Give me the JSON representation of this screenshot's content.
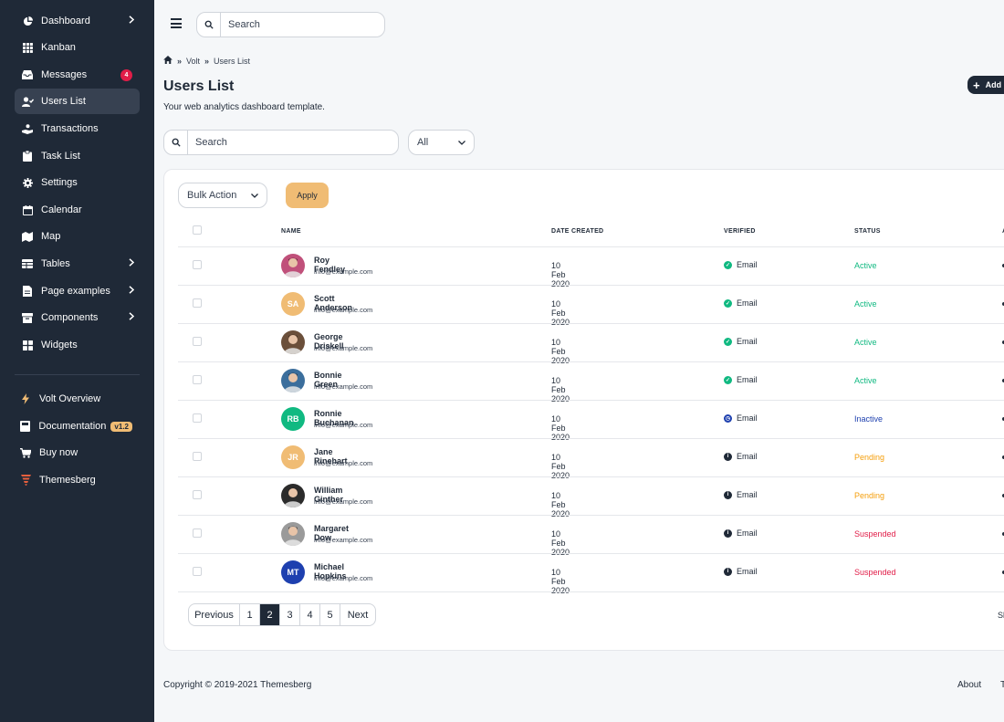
{
  "sidebar": {
    "items": [
      {
        "label": "Dashboard",
        "icon": "pie-chart-icon",
        "chevron": true
      },
      {
        "label": "Kanban",
        "icon": "grid-icon"
      },
      {
        "label": "Messages",
        "icon": "inbox-icon",
        "badge": "4"
      },
      {
        "label": "Users List",
        "icon": "user-check-icon",
        "active": true
      },
      {
        "label": "Transactions",
        "icon": "hand-coin-icon"
      },
      {
        "label": "Task List",
        "icon": "clipboard-icon"
      },
      {
        "label": "Settings",
        "icon": "gear-icon"
      },
      {
        "label": "Calendar",
        "icon": "calendar-icon"
      },
      {
        "label": "Map",
        "icon": "map-icon"
      },
      {
        "label": "Tables",
        "icon": "table-icon",
        "chevron": true
      },
      {
        "label": "Page examples",
        "icon": "document-icon",
        "chevron": true
      },
      {
        "label": "Components",
        "icon": "box-icon",
        "chevron": true
      },
      {
        "label": "Widgets",
        "icon": "widgets-icon"
      }
    ],
    "bottom_items": [
      {
        "label": "Volt Overview",
        "icon": "bolt-icon"
      },
      {
        "label": "Documentation",
        "icon": "book-icon",
        "badge": "v1.2"
      },
      {
        "label": "Buy now",
        "icon": "cart-icon"
      },
      {
        "label": "Themesberg",
        "icon": "themesberg-logo-icon"
      }
    ]
  },
  "topbar": {
    "search_placeholder": "Search"
  },
  "breadcrumb": {
    "items": [
      "Volt",
      "Users List"
    ]
  },
  "page": {
    "title": "Users List",
    "subtitle": "Your web analytics dashboard template.",
    "add_label": "Add"
  },
  "filters": {
    "search_placeholder": "Search",
    "select_value": "All"
  },
  "table": {
    "bulk_action": "Bulk Action",
    "apply": "Apply",
    "columns": [
      "NAME",
      "DATE CREATED",
      "VERIFIED",
      "STATUS",
      "A"
    ],
    "rows": [
      {
        "name": "Roy Fendley",
        "email": "info@example.com",
        "date": "10 Feb 2020",
        "verified": "Email",
        "verified_type": "check",
        "status": "Active",
        "avatar": "photo",
        "avatar_color": "#c0507a"
      },
      {
        "name": "Scott Anderson",
        "email": "info@example.com",
        "date": "10 Feb 2020",
        "verified": "Email",
        "verified_type": "check",
        "status": "Active",
        "avatar": "SA",
        "avatar_color": "#f0bc74"
      },
      {
        "name": "George Driskell",
        "email": "info@example.com",
        "date": "10 Feb 2020",
        "verified": "Email",
        "verified_type": "check",
        "status": "Active",
        "avatar": "photo",
        "avatar_color": "#6b4f3a"
      },
      {
        "name": "Bonnie Green",
        "email": "info@example.com",
        "date": "10 Feb 2020",
        "verified": "Email",
        "verified_type": "check",
        "status": "Active",
        "avatar": "photo",
        "avatar_color": "#3b6e9c"
      },
      {
        "name": "Ronnie Buchanan",
        "email": "info@example.com",
        "date": "10 Feb 2020",
        "verified": "Email",
        "verified_type": "clock",
        "status": "Inactive",
        "avatar": "RB",
        "avatar_color": "#10b981"
      },
      {
        "name": "Jane Rinehart",
        "email": "info@example.com",
        "date": "10 Feb 2020",
        "verified": "Email",
        "verified_type": "info",
        "status": "Pending",
        "avatar": "JR",
        "avatar_color": "#f0bc74"
      },
      {
        "name": "William Ginther",
        "email": "info@example.com",
        "date": "10 Feb 2020",
        "verified": "Email",
        "verified_type": "info",
        "status": "Pending",
        "avatar": "photo",
        "avatar_color": "#2b2b2b"
      },
      {
        "name": "Margaret Dow",
        "email": "info@example.com",
        "date": "10 Feb 2020",
        "verified": "Email",
        "verified_type": "info",
        "status": "Suspended",
        "avatar": "photo",
        "avatar_color": "#9a9a9a"
      },
      {
        "name": "Michael Hopkins",
        "email": "info@example.com",
        "date": "10 Feb 2020",
        "verified": "Email",
        "verified_type": "info",
        "status": "Suspended",
        "avatar": "MT",
        "avatar_color": "#1e40af"
      }
    ]
  },
  "pagination": {
    "previous": "Previous",
    "pages": [
      "1",
      "2",
      "3",
      "4",
      "5"
    ],
    "active_page": "2",
    "next": "Next",
    "showing": "Sh"
  },
  "footer": {
    "copyright": "Copyright © 2019-2021 Themesberg",
    "about": "About",
    "t": "T"
  },
  "colors": {
    "sidebar_bg": "#1f2937",
    "active": "#10b981",
    "inactive": "#1e40af",
    "pending": "#f59e0b",
    "suspended": "#e11d48",
    "apply": "#f0bc74"
  }
}
